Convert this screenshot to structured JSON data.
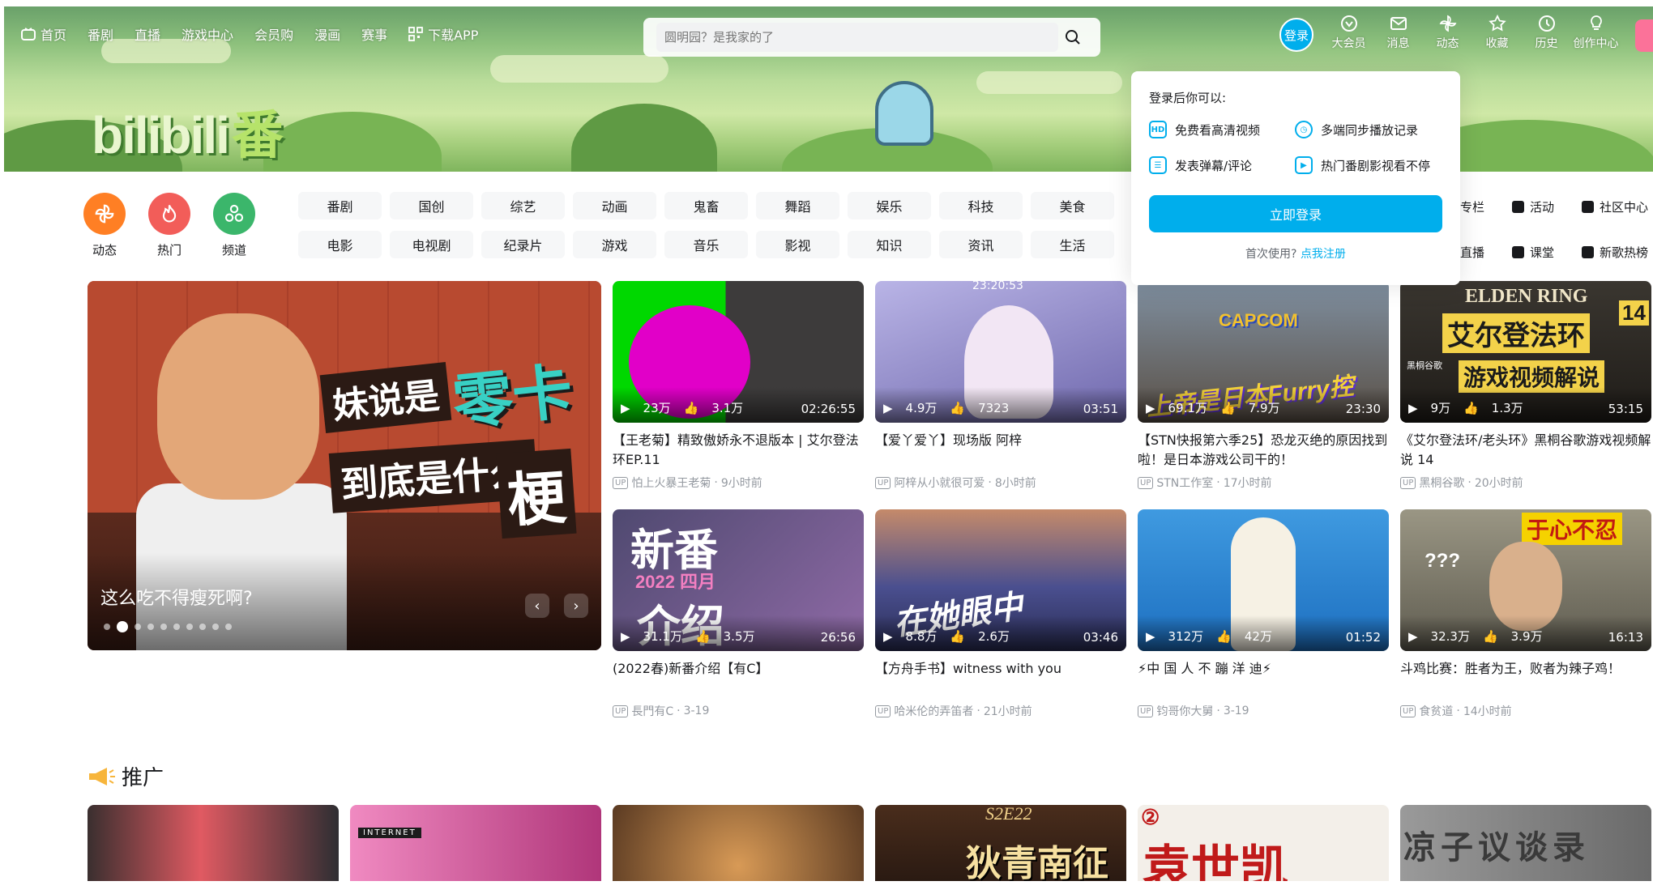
{
  "nav": {
    "left": [
      "首页",
      "番剧",
      "直播",
      "游戏中心",
      "会员购",
      "漫画",
      "赛事",
      "下载APP"
    ],
    "search_placeholder": "圆明园？是我家的了",
    "login": "登录",
    "right": [
      "大会员",
      "消息",
      "动态",
      "收藏",
      "历史",
      "创作中心"
    ]
  },
  "banner": {
    "logo_main": "bilibili",
    "logo_sub": "番"
  },
  "channels": {
    "icons": [
      {
        "label": "动态",
        "color": "#ff7f24"
      },
      {
        "label": "热门",
        "color": "#f25d59"
      },
      {
        "label": "频道",
        "color": "#3bb66b"
      }
    ],
    "tags_row1": [
      "番剧",
      "国创",
      "综艺",
      "动画",
      "鬼畜",
      "舞蹈",
      "娱乐",
      "科技",
      "美食"
    ],
    "tags_row2": [
      "电影",
      "电视剧",
      "纪录片",
      "游戏",
      "音乐",
      "影视",
      "知识",
      "资讯",
      "生活"
    ],
    "right_links": [
      "专栏",
      "活动",
      "社区中心",
      "直播",
      "课堂",
      "新歌热榜"
    ]
  },
  "carousel": {
    "title": "这么吃不得瘦死啊?",
    "overlay_texts": [
      "妹说是",
      "零卡",
      "到底是什么",
      "梗"
    ],
    "dots": 10,
    "active_dot": 1
  },
  "videos": [
    {
      "plays": "23万",
      "likes": "3.1万",
      "duration": "02:26:55",
      "title": "【王老菊】精致傲娇永不退版本 | 艾尔登法环EP.11",
      "author": "怕上火暴王老菊",
      "time": "9小时前",
      "bg": "#2a2a2a"
    },
    {
      "plays": "4.9万",
      "likes": "7323",
      "duration": "03:51",
      "title": "【爱丫爱丫】现场版 阿梓",
      "author": "阿梓从小就很可爱",
      "time": "8小时前",
      "bg": "#8f86c7"
    },
    {
      "plays": "69.1万",
      "likes": "7.9万",
      "duration": "23:30",
      "title": "【STN快报第六季25】恐龙灭绝的原因找到啦！是日本游戏公司干的！",
      "author": "STN工作室",
      "time": "17小时前",
      "bg": "#6a7a8a"
    },
    {
      "plays": "9万",
      "likes": "1.3万",
      "duration": "53:15",
      "title": "《艾尔登法环/老头环》黑桐谷歌游戏视频解说 14",
      "author": "黑桐谷歌",
      "time": "20小时前",
      "bg": "#2d2a26"
    },
    {
      "plays": "31.1万",
      "likes": "3.5万",
      "duration": "26:56",
      "title": "(2022春)新番介绍【有C】",
      "author": "長門有C",
      "time": "3-19",
      "bg": "#6e5a8c"
    },
    {
      "plays": "8.8万",
      "likes": "2.6万",
      "duration": "03:46",
      "title": "【方舟手书】witness with you",
      "author": "哈米伦的弄笛者",
      "time": "21小时前",
      "bg": "#3e4f8c"
    },
    {
      "plays": "312万",
      "likes": "42万",
      "duration": "01:52",
      "title": "⚡中 国 人 不 蹦 洋 迪⚡",
      "author": "钧哥你大舅",
      "time": "3-19",
      "bg": "#2f8ad1"
    },
    {
      "plays": "32.3万",
      "likes": "3.9万",
      "duration": "16:13",
      "title": "斗鸡比赛：胜者为王，败者为辣子鸡！",
      "author": "食贫道",
      "time": "14小时前",
      "bg": "#7a7466"
    }
  ],
  "thumb_texts": {
    "v4a": "ELDEN RING",
    "v4b": "艾尔登法环",
    "v4c": "游戏视频解说",
    "v4d": "14",
    "v4e": "黑桐谷歌",
    "v3a": "CAPCOM",
    "v3b": "上帝是日本Furry控",
    "v5a": "新番",
    "v5b": "2022 四月",
    "v5c": "介绍",
    "v6a": "在她眼中",
    "v8a": "于心不忍",
    "v8b": "???",
    "v2a": "23:20:53"
  },
  "promo": {
    "title": "推广",
    "thumbs": [
      {
        "bg": "#3a2f2f",
        "text": ""
      },
      {
        "bg": "#e86aa8",
        "text": "INTERNET"
      },
      {
        "bg": "#6b4a2a",
        "text": ""
      },
      {
        "bg": "#5a3a26",
        "text": "狄青南征"
      },
      {
        "bg": "#f3efe9",
        "text": "袁世凯"
      },
      {
        "bg": "#8a8a8a",
        "text": "凉子议谈录"
      }
    ],
    "badges": [
      "S2E22",
      "②"
    ]
  },
  "login_popup": {
    "heading": "登录后你可以:",
    "items": [
      "免费看高清视频",
      "多端同步播放记录",
      "发表弹幕/评论",
      "热门番剧影视看不停"
    ],
    "button": "立即登录",
    "first_time": "首次使用?",
    "register": "点我注册"
  }
}
